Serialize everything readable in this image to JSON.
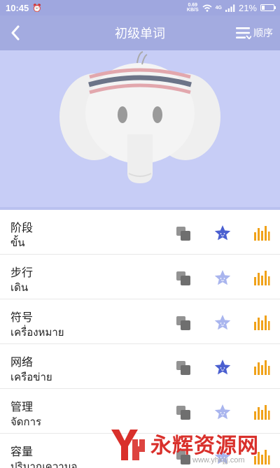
{
  "status_bar": {
    "time": "10:45",
    "net_speed_value": "0.69",
    "net_speed_unit": "KB/S",
    "network_type": "4G",
    "battery": "21%",
    "battery_level": 0.21
  },
  "nav": {
    "title": "初级单词",
    "order_label": "顺序"
  },
  "words": [
    {
      "cn": "阶段",
      "th": "ขั้น",
      "starred": true
    },
    {
      "cn": "步行",
      "th": "เดิน",
      "starred": false
    },
    {
      "cn": "符号",
      "th": "เครื่องหมาย",
      "starred": false
    },
    {
      "cn": "网络",
      "th": "เครือข่าย",
      "starred": true
    },
    {
      "cn": "管理",
      "th": "จัดการ",
      "starred": false
    },
    {
      "cn": "容量",
      "th": "ปริมาณความจ",
      "starred": false
    }
  ],
  "watermark": {
    "brand": "永辉资源网",
    "url": "www.yhkjjj.com"
  },
  "colors": {
    "nav_bg": "#a3abe0",
    "hero_bg": "#c7cdf6",
    "star_on": "#4a5fd0",
    "star_off": "#a9b5ee",
    "bars": "#f0a21a",
    "copy": "#6f6f6f"
  }
}
